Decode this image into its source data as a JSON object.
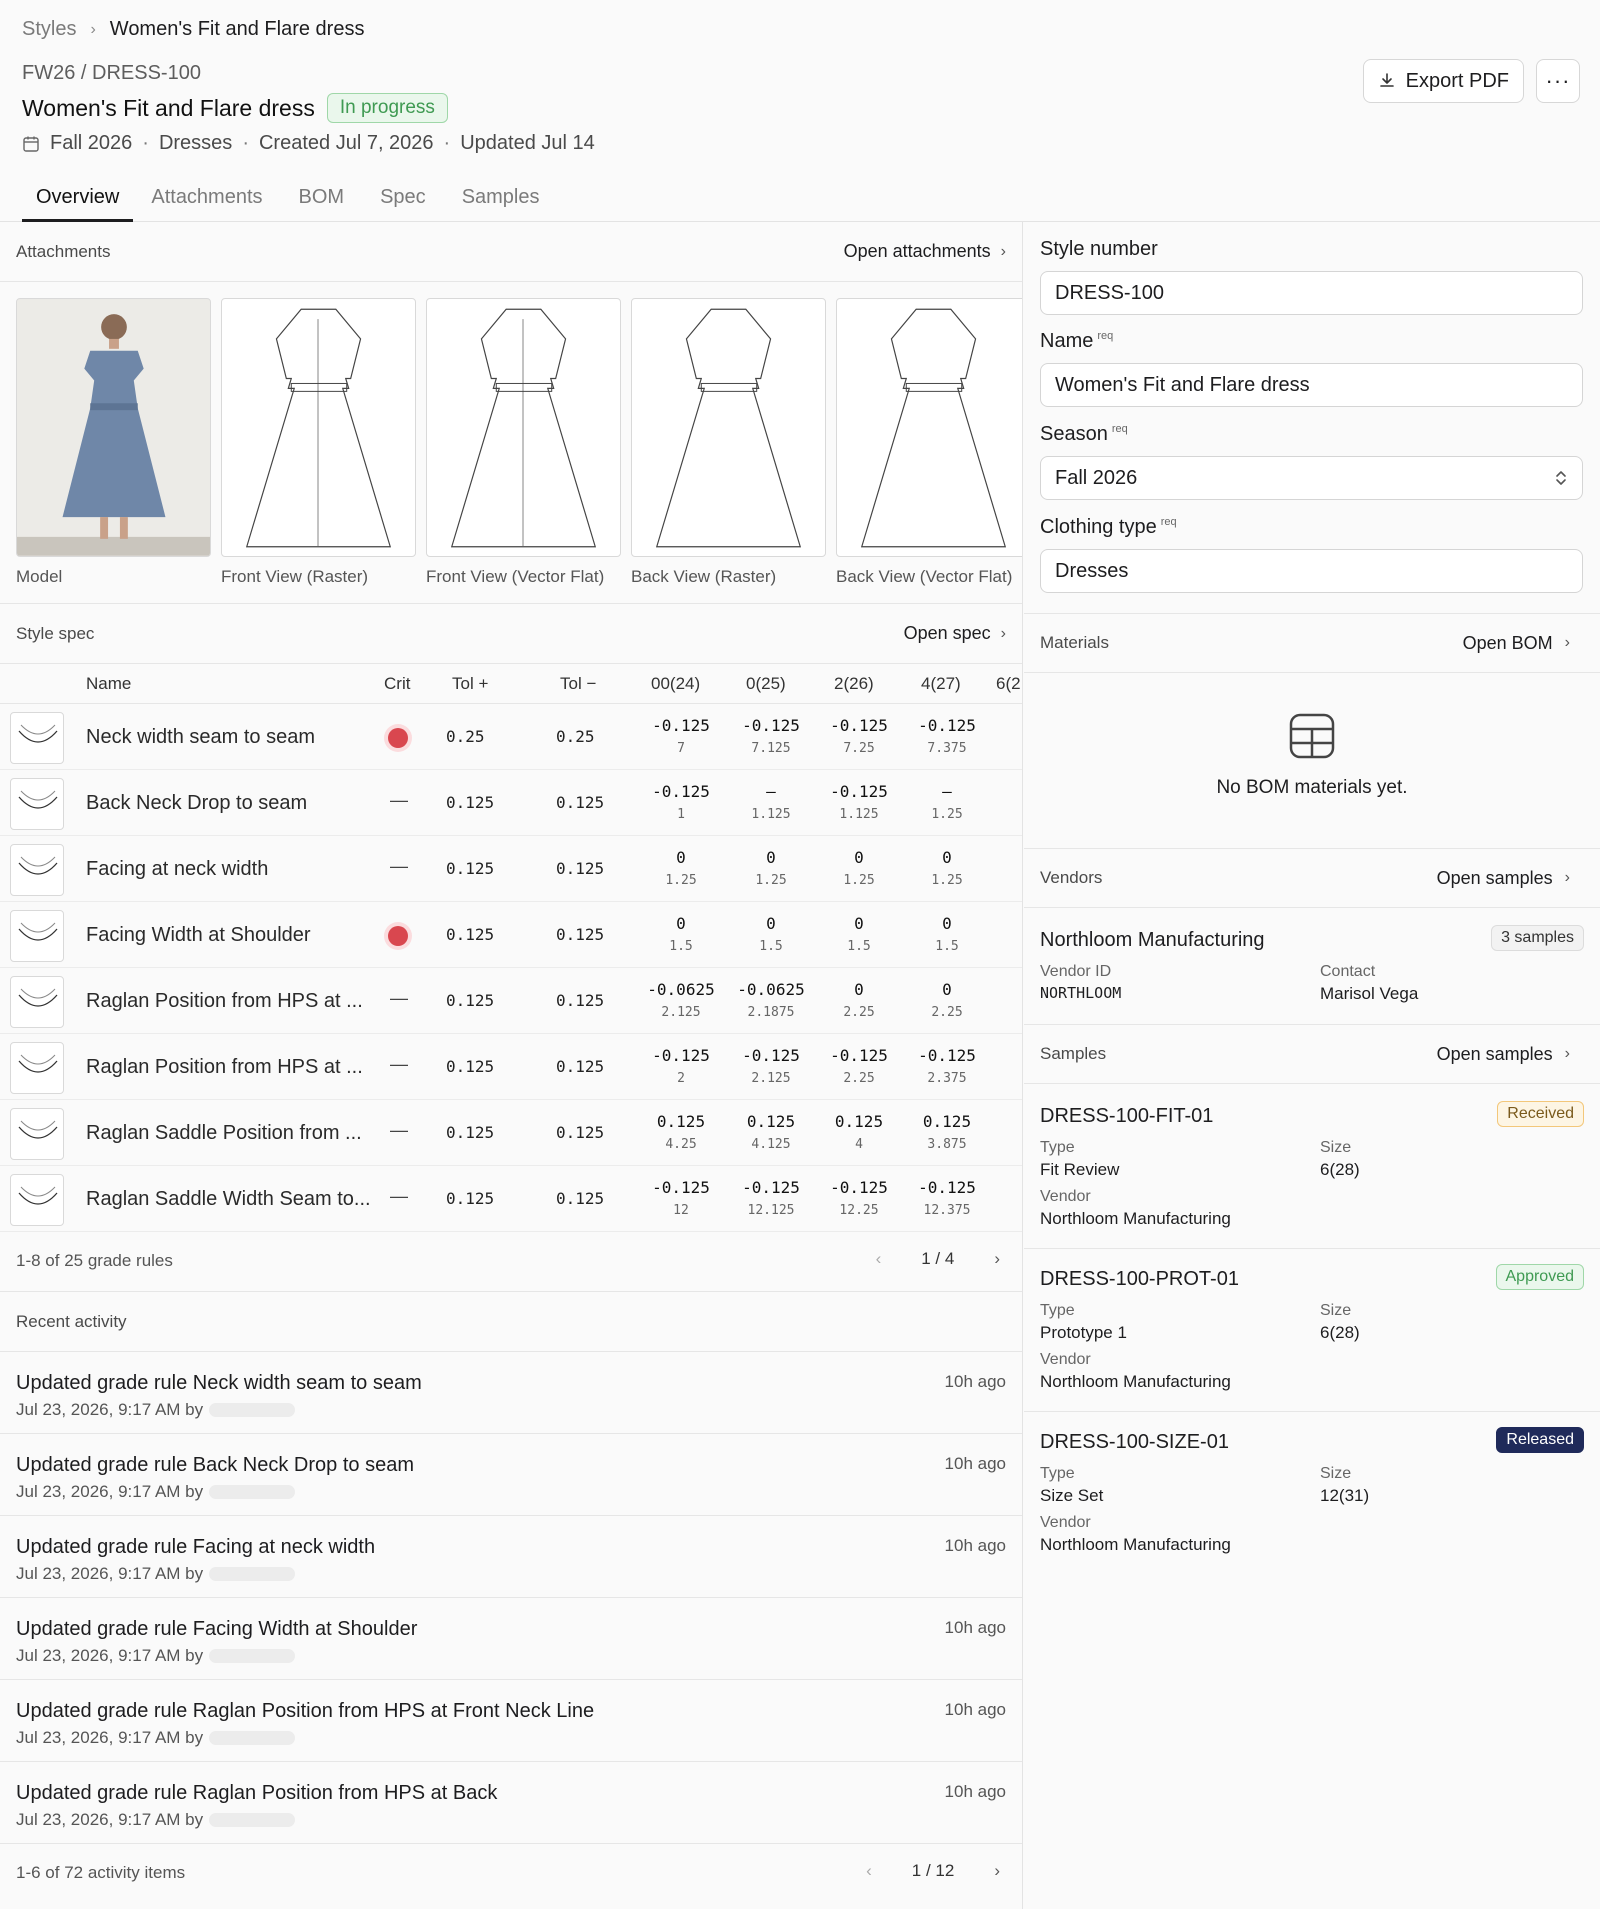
{
  "breadcrumb": {
    "root": "Styles",
    "current": "Women's Fit and Flare dress"
  },
  "style": {
    "code": "FW26 / DRESS-100",
    "title": "Women's Fit and Flare dress",
    "status": "In progress",
    "season": "Fall 2026",
    "category": "Dresses",
    "created": "Created Jul 7, 2026",
    "updated": "Updated Jul 14"
  },
  "actions": {
    "export": "Export PDF",
    "more": "···"
  },
  "tabs": [
    "Overview",
    "Attachments",
    "BOM",
    "Spec",
    "Samples"
  ],
  "attachments": {
    "heading": "Attachments",
    "link": "Open attachments",
    "items": [
      "Model",
      "Front View (Raster)",
      "Front View (Vector Flat)",
      "Back View (Raster)",
      "Back View (Vector Flat)"
    ]
  },
  "spec": {
    "heading": "Style spec",
    "link": "Open spec",
    "columns": {
      "name": "Name",
      "crit": "Crit",
      "tolp": "Tol +",
      "tolm": "Tol −",
      "sizes": [
        "00(24)",
        "0(25)",
        "2(26)",
        "4(27)",
        "6(2"
      ]
    },
    "rows": [
      {
        "name": "Neck width seam to seam",
        "crit": true,
        "tolp": "0.25",
        "tolm": "0.25",
        "cells": [
          [
            "-0.125",
            "7"
          ],
          [
            "-0.125",
            "7.125"
          ],
          [
            "-0.125",
            "7.25"
          ],
          [
            "-0.125",
            "7.375"
          ]
        ]
      },
      {
        "name": "Back Neck Drop to seam",
        "crit": false,
        "tolp": "0.125",
        "tolm": "0.125",
        "cells": [
          [
            "-0.125",
            "1"
          ],
          [
            "—",
            "1.125"
          ],
          [
            "-0.125",
            "1.125"
          ],
          [
            "—",
            "1.25"
          ]
        ]
      },
      {
        "name": "Facing at neck width",
        "crit": false,
        "tolp": "0.125",
        "tolm": "0.125",
        "cells": [
          [
            "0",
            "1.25"
          ],
          [
            "0",
            "1.25"
          ],
          [
            "0",
            "1.25"
          ],
          [
            "0",
            "1.25"
          ]
        ]
      },
      {
        "name": "Facing Width at Shoulder",
        "crit": true,
        "tolp": "0.125",
        "tolm": "0.125",
        "cells": [
          [
            "0",
            "1.5"
          ],
          [
            "0",
            "1.5"
          ],
          [
            "0",
            "1.5"
          ],
          [
            "0",
            "1.5"
          ]
        ]
      },
      {
        "name": "Raglan Position from HPS at ...",
        "crit": false,
        "tolp": "0.125",
        "tolm": "0.125",
        "cells": [
          [
            "-0.0625",
            "2.125"
          ],
          [
            "-0.0625",
            "2.1875"
          ],
          [
            "0",
            "2.25"
          ],
          [
            "0",
            "2.25"
          ]
        ]
      },
      {
        "name": "Raglan Position from HPS at ...",
        "crit": false,
        "tolp": "0.125",
        "tolm": "0.125",
        "cells": [
          [
            "-0.125",
            "2"
          ],
          [
            "-0.125",
            "2.125"
          ],
          [
            "-0.125",
            "2.25"
          ],
          [
            "-0.125",
            "2.375"
          ]
        ]
      },
      {
        "name": "Raglan Saddle Position from ...",
        "crit": false,
        "tolp": "0.125",
        "tolm": "0.125",
        "cells": [
          [
            "0.125",
            "4.25"
          ],
          [
            "0.125",
            "4.125"
          ],
          [
            "0.125",
            "4"
          ],
          [
            "0.125",
            "3.875"
          ]
        ]
      },
      {
        "name": "Raglan Saddle Width Seam to...",
        "crit": false,
        "tolp": "0.125",
        "tolm": "0.125",
        "cells": [
          [
            "-0.125",
            "12"
          ],
          [
            "-0.125",
            "12.125"
          ],
          [
            "-0.125",
            "12.25"
          ],
          [
            "-0.125",
            "12.375"
          ]
        ]
      }
    ],
    "dash": "—",
    "count": "1-8 of 25 grade rules",
    "page": "1 / 4"
  },
  "activity": {
    "heading": "Recent activity",
    "items": [
      {
        "title": "Updated grade rule Neck width seam to seam",
        "date": "Jul 23, 2026, 9:17 AM by",
        "ago": "10h ago"
      },
      {
        "title": "Updated grade rule Back Neck Drop to seam",
        "date": "Jul 23, 2026, 9:17 AM by",
        "ago": "10h ago"
      },
      {
        "title": "Updated grade rule Facing at neck width",
        "date": "Jul 23, 2026, 9:17 AM by",
        "ago": "10h ago"
      },
      {
        "title": "Updated grade rule Facing Width at Shoulder",
        "date": "Jul 23, 2026, 9:17 AM by",
        "ago": "10h ago"
      },
      {
        "title": "Updated grade rule Raglan Position from HPS at Front Neck Line",
        "date": "Jul 23, 2026, 9:17 AM by",
        "ago": "10h ago"
      },
      {
        "title": "Updated grade rule Raglan Position from HPS at Back",
        "date": "Jul 23, 2026, 9:17 AM by",
        "ago": "10h ago"
      }
    ],
    "count": "1-6 of 72 activity items",
    "page": "1 / 12"
  },
  "form": {
    "style_number_label": "Style number",
    "style_number": "DRESS-100",
    "name_label": "Name",
    "name": "Women's Fit and Flare dress",
    "season_label": "Season",
    "season": "Fall 2026",
    "type_label": "Clothing type",
    "type": "Dresses",
    "req": "req"
  },
  "materials": {
    "heading": "Materials",
    "link": "Open BOM",
    "empty": "No BOM materials yet."
  },
  "vendors": {
    "heading": "Vendors",
    "link": "Open samples",
    "name": "Northloom Manufacturing",
    "samples": "3 samples",
    "id_label": "Vendor ID",
    "id": "NORTHLOOM",
    "contact_label": "Contact",
    "contact": "Marisol Vega"
  },
  "samples": {
    "heading": "Samples",
    "link": "Open samples",
    "type_label": "Type",
    "size_label": "Size",
    "vendor_label": "Vendor",
    "items": [
      {
        "id": "DRESS-100-FIT-01",
        "status": "Received",
        "type": "Fit Review",
        "size": "6(28)",
        "vendor": "Northloom Manufacturing"
      },
      {
        "id": "DRESS-100-PROT-01",
        "status": "Approved",
        "type": "Prototype 1",
        "size": "6(28)",
        "vendor": "Northloom Manufacturing"
      },
      {
        "id": "DRESS-100-SIZE-01",
        "status": "Released",
        "type": "Size Set",
        "size": "12(31)",
        "vendor": "Northloom Manufacturing"
      }
    ]
  },
  "colors": {
    "accent_green": "#3f9a52",
    "crit_red": "#d9474f",
    "received": "#f3c77a",
    "approved": "#9fd7a8",
    "released": "#1f2a5a"
  }
}
